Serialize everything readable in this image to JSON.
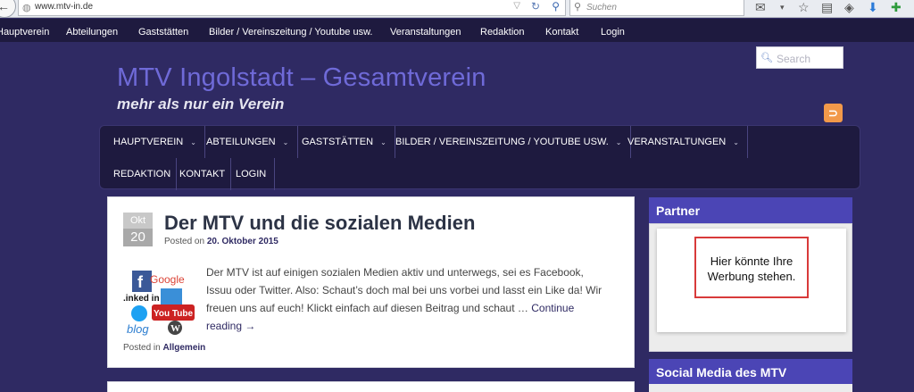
{
  "browser": {
    "url": "www.mtv-in.de",
    "search_placeholder": "Suchen"
  },
  "topnav": {
    "items": [
      "Hauptverein",
      "Abteilungen",
      "Gaststätten",
      "Bilder / Vereinszeitung / Youtube usw.",
      "Veranstaltungen",
      "Redaktion",
      "Kontakt",
      "Login"
    ]
  },
  "header": {
    "title": "MTV Ingolstadt – Gesamtverein",
    "tagline": "mehr als nur ein Verein",
    "search_placeholder": "Search"
  },
  "mainnav": {
    "items": [
      "HAUPTVEREIN",
      "ABTEILUNGEN",
      "GASTSTÄTTEN",
      "BILDER / VEREINSZEITUNG / YOUTUBE USW.",
      "VERANSTALTUNGEN",
      "REDAKTION",
      "KONTAKT",
      "LOGIN"
    ]
  },
  "post": {
    "month": "Okt",
    "day": "20",
    "title": "Der MTV und die sozialen Medien",
    "posted_on_label": "Posted on",
    "date": "20. Oktober 2015",
    "body": "Der MTV ist auf einigen sozialen Medien aktiv und unterwegs, sei es Facebook, Issuu oder Twitter. Also: Schaut’s doch mal bei uns vorbei und lasst ein Like da! Wir freuen uns auf euch! Klickt einfach auf diesen Beitrag und schaut …",
    "more_link": "Continue reading →",
    "posted_in_label": "Posted in",
    "category": "Allgemein",
    "thumb_labels": [
      "Google",
      ".inked in",
      "You Tube",
      "blog"
    ]
  },
  "sidebar": {
    "partner_title": "Partner",
    "ad_text": "Hier könnte Ihre Werbung stehen.",
    "social_title": "Social Media des MTV"
  },
  "colors": {
    "page_bg": "#2f2a63",
    "nav_bg": "#1e1a3f",
    "title": "#6f6ad8",
    "widget_head": "#4b45b5",
    "ad_border": "#d83a3a"
  }
}
